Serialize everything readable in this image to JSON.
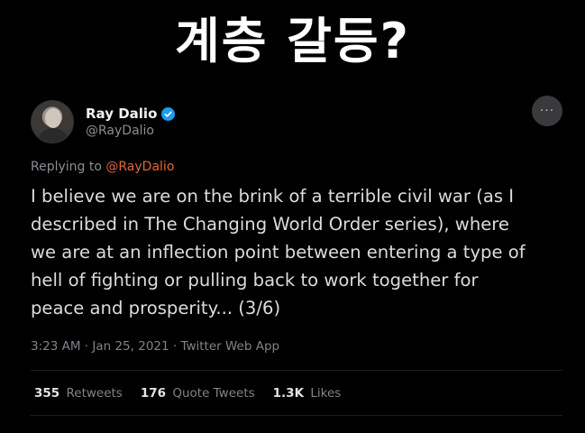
{
  "headline": "계층 갈등?",
  "tweet": {
    "display_name": "Ray Dalio",
    "handle": "@RayDalio",
    "replying_prefix": "Replying to",
    "replying_to": "@RayDalio",
    "text_lines": [
      "I believe we are on the brink of a terrible civil war (as I",
      "described in The Changing World Order series), where",
      "we are at an inflection point between entering a type of",
      "hell of fighting or pulling back to work together for",
      "peace and prosperity... (3/6)"
    ],
    "timestamp": "3:23 AM · Jan 25, 2021 · Twitter Web App",
    "more_icon": "···",
    "stats": {
      "retweets_count": "355",
      "retweets_label": "Retweets",
      "quotes_count": "176",
      "quotes_label": "Quote Tweets",
      "likes_count": "1.3K",
      "likes_label": "Likes"
    }
  },
  "colors": {
    "background": "#000000",
    "mention": "#e0683c",
    "verified": "#1d9bf0",
    "muted": "#8a8f94"
  }
}
